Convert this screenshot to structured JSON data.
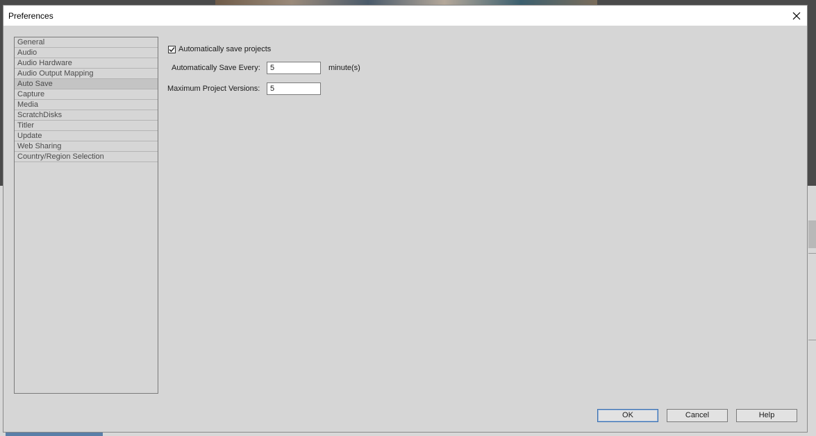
{
  "window": {
    "title": "Preferences",
    "close_icon": "close-icon"
  },
  "categories": [
    {
      "label": "General",
      "selected": false
    },
    {
      "label": "Audio",
      "selected": false
    },
    {
      "label": "Audio Hardware",
      "selected": false
    },
    {
      "label": "Audio Output Mapping",
      "selected": false
    },
    {
      "label": "Auto Save",
      "selected": true
    },
    {
      "label": "Capture",
      "selected": false
    },
    {
      "label": "Media",
      "selected": false
    },
    {
      "label": "ScratchDisks",
      "selected": false
    },
    {
      "label": "Titler",
      "selected": false
    },
    {
      "label": "Update",
      "selected": false
    },
    {
      "label": "Web Sharing",
      "selected": false
    },
    {
      "label": "Country/Region Selection",
      "selected": false
    }
  ],
  "auto_save": {
    "checkbox_label": "Automatically save projects",
    "checked": true,
    "save_every_label": "Automatically Save Every:",
    "save_every_value": "5",
    "save_every_unit": "minute(s)",
    "max_versions_label": "Maximum Project Versions:",
    "max_versions_value": "5"
  },
  "buttons": {
    "ok": "OK",
    "cancel": "Cancel",
    "help": "Help"
  },
  "colors": {
    "dialog_bg": "#d6d6d6",
    "selected_item": "#c4c4c4",
    "default_button_border": "#3a6fb0"
  }
}
